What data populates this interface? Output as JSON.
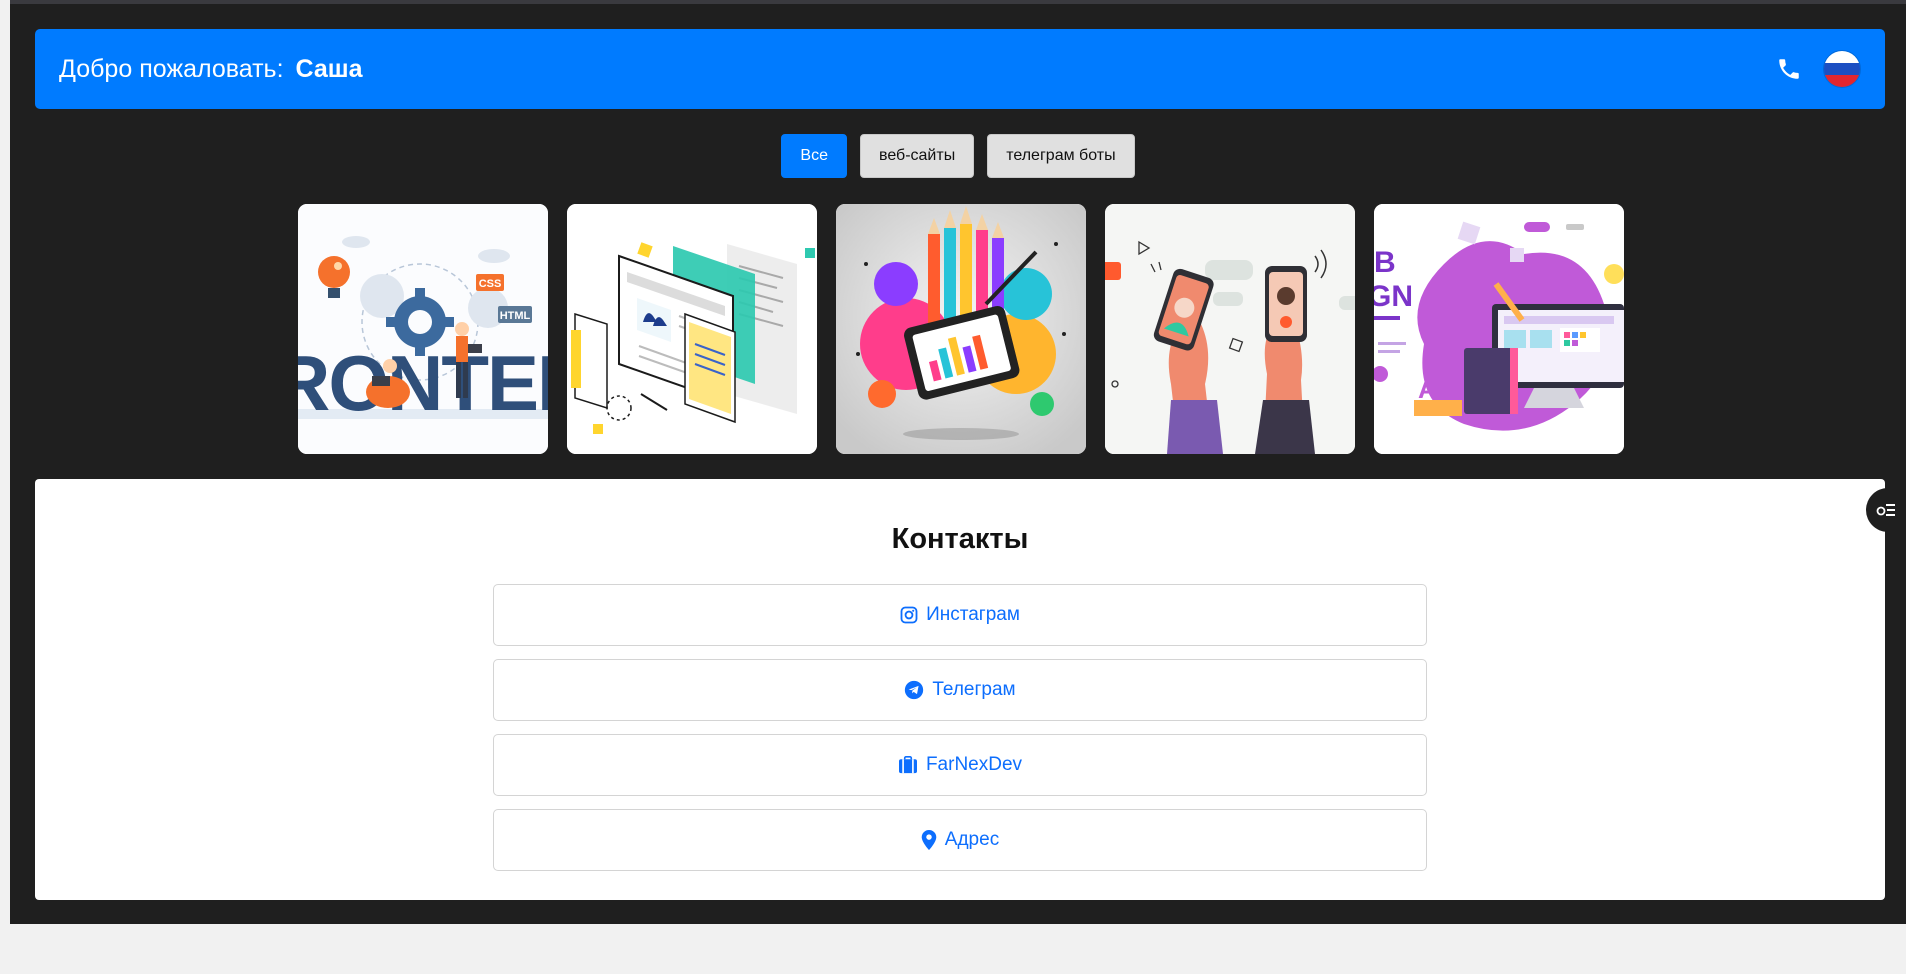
{
  "header": {
    "welcome_text": "Добро пожаловать:",
    "username": "Саша",
    "phone_icon": "phone-icon",
    "language_icon": "russia-flag-icon"
  },
  "filters": [
    {
      "label": "Все",
      "active": true
    },
    {
      "label": "веб-сайты",
      "active": false
    },
    {
      "label": "телеграм боты",
      "active": false
    }
  ],
  "gallery": [
    {
      "name": "frontend-illustration",
      "caption": "RONTEN"
    },
    {
      "name": "web-pages-illustration",
      "caption": ""
    },
    {
      "name": "design-tools-illustration",
      "caption": ""
    },
    {
      "name": "mobile-chat-illustration",
      "caption": ""
    },
    {
      "name": "web-design-illustration",
      "caption": ""
    }
  ],
  "contacts": {
    "title": "Контакты",
    "items": [
      {
        "label": "Инстаграм",
        "icon": "instagram-icon"
      },
      {
        "label": "Телеграм",
        "icon": "telegram-icon"
      },
      {
        "label": "FarNexDev",
        "icon": "briefcase-icon"
      },
      {
        "label": "Адрес",
        "icon": "map-marker-icon"
      }
    ]
  },
  "colors": {
    "primary": "#007bff",
    "page_background": "#1f1f1f",
    "link": "#0d6efd"
  }
}
